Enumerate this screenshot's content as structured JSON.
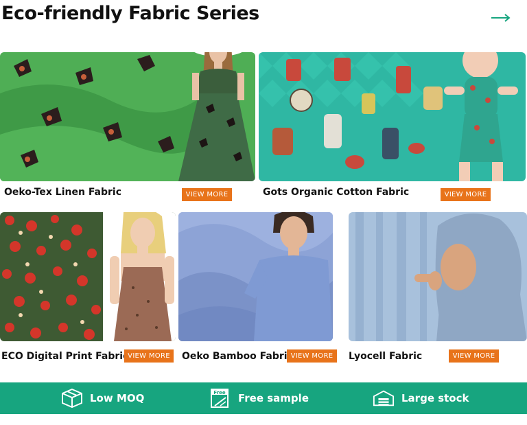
{
  "header": {
    "title": "Eco-friendly Fabric Series",
    "arrow_icon": "arrow-right-icon",
    "accent_color": "#17a57f"
  },
  "cards": [
    {
      "label": "Oeko-Tex Linen Fabric",
      "button": "VIEW MORE",
      "image": "green-butterfly-linen-dress"
    },
    {
      "label": "Gots Organic Cotton Fabric",
      "button": "VIEW MORE",
      "image": "teal-wonderland-print-baby-romper"
    },
    {
      "label": "ECO Digital Print Fabric",
      "button": "VIEW MORE",
      "image": "red-floral-print-sundress"
    },
    {
      "label": "Oeko Bamboo Fabric",
      "button": "VIEW MORE",
      "image": "blue-bamboo-tshirt-man"
    },
    {
      "label": "Lyocell Fabric",
      "button": "VIEW MORE",
      "image": "light-blue-lyocell-hijab"
    }
  ],
  "button_color": "#e8731a",
  "features": [
    {
      "label": "Low MOQ",
      "icon": "box-icon"
    },
    {
      "label": "Free sample",
      "icon": "free-sample-icon",
      "icon_text": "Free"
    },
    {
      "label": "Large stock",
      "icon": "warehouse-icon"
    }
  ]
}
